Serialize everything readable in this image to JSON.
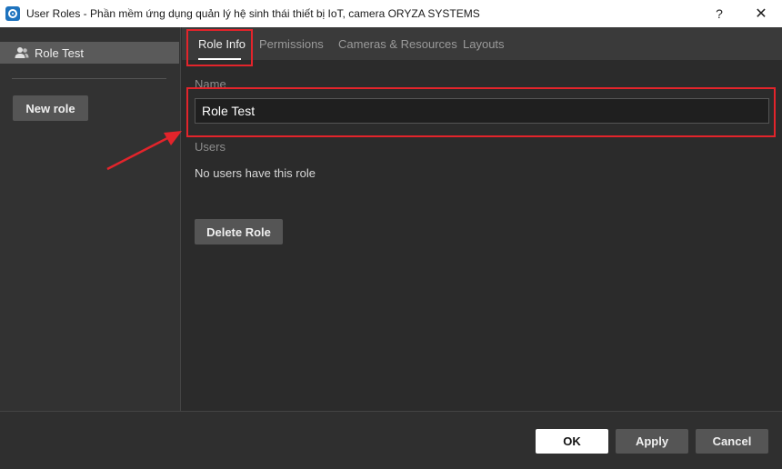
{
  "window": {
    "title": "User Roles - Phần mềm ứng dụng quản lý hệ sinh thái thiết bị IoT, camera ORYZA SYSTEMS",
    "help_glyph": "?",
    "close_glyph": "✕"
  },
  "sidebar": {
    "roles": [
      {
        "label": "Role Test",
        "icon": "user-group-icon"
      }
    ],
    "new_role_label": "New role"
  },
  "tabs": [
    {
      "label": "Role Info",
      "active": true
    },
    {
      "label": "Permissions",
      "active": false
    },
    {
      "label": "Cameras & Resources",
      "active": false
    },
    {
      "label": "Layouts",
      "active": false
    }
  ],
  "role_info": {
    "name_label": "Name",
    "name_value": "Role Test",
    "users_label": "Users",
    "no_users_text": "No users have this role",
    "delete_label": "Delete Role"
  },
  "footer": {
    "ok_label": "OK",
    "apply_label": "Apply",
    "cancel_label": "Cancel"
  },
  "colors": {
    "annotation": "#e3242b",
    "accent": "#1e73be"
  }
}
